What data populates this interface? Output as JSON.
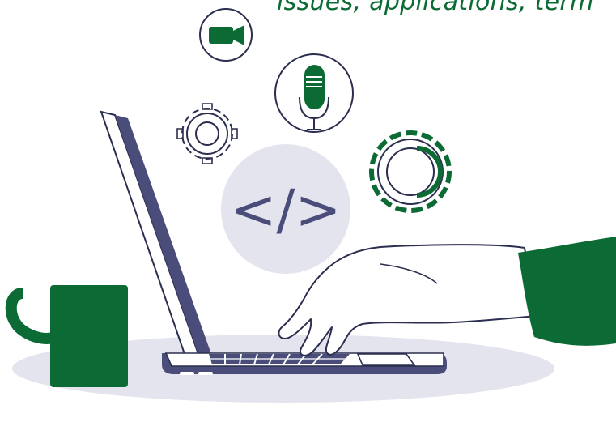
{
  "caption": {
    "text": "issues, applications, term"
  },
  "illustration": {
    "code_symbol": "</>",
    "icons": [
      "video-camera-icon",
      "microphone-icon",
      "gear-icon",
      "gear-icon",
      "code-icon"
    ]
  },
  "colors": {
    "brand_green": "#0c6b34",
    "navy": "#4a4d7a",
    "light_lavender": "#e4e4ee",
    "outline": "#2b2e4f",
    "white": "#ffffff"
  }
}
